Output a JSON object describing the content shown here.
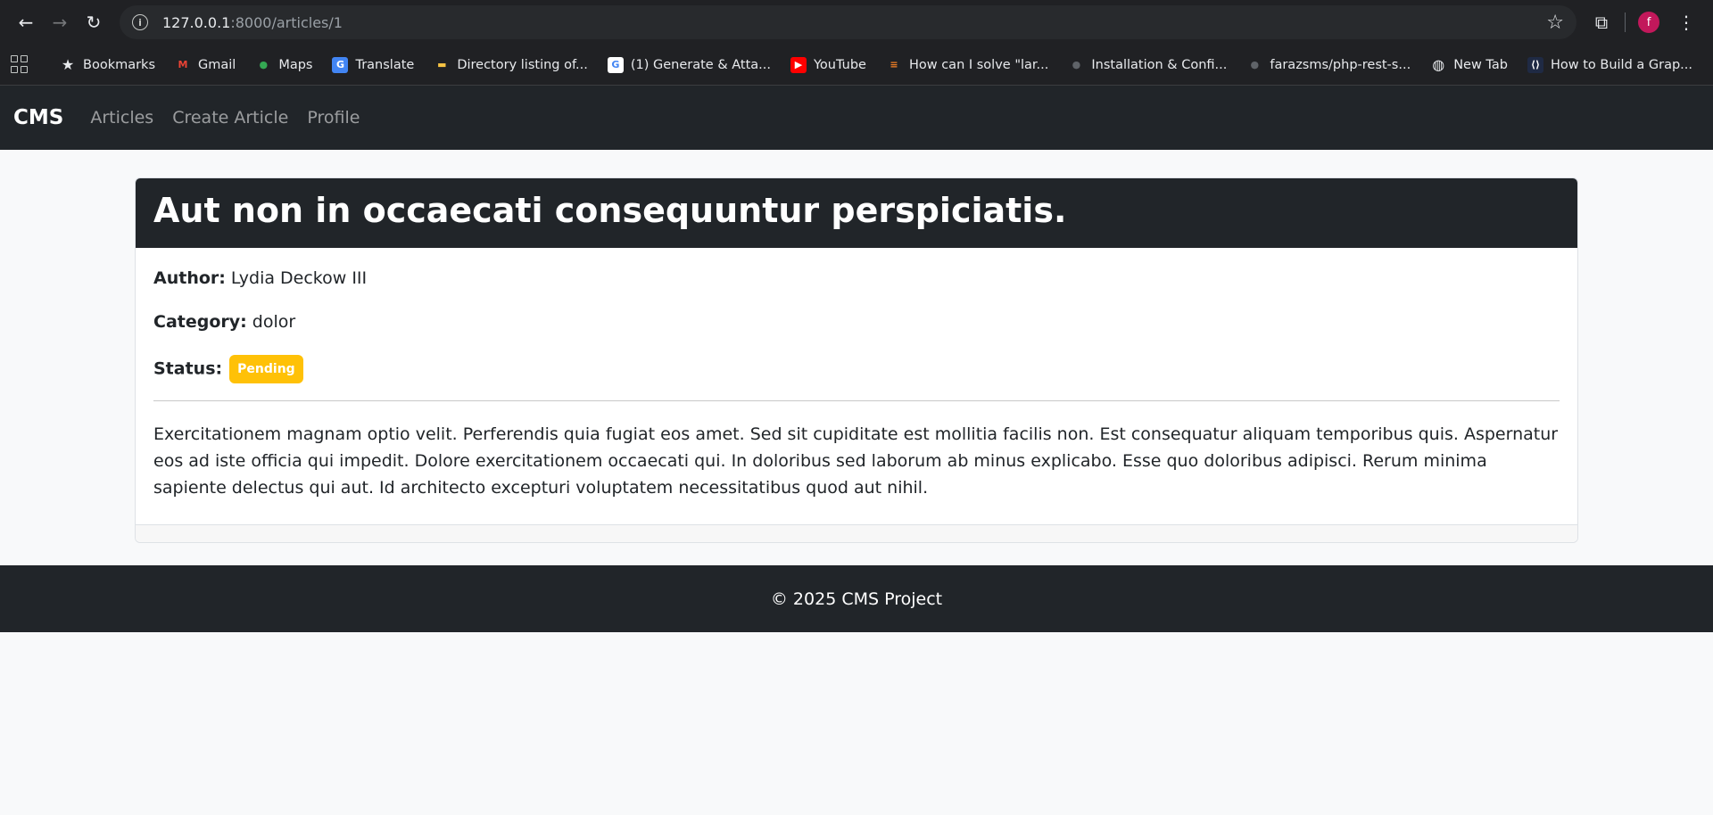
{
  "browser": {
    "url_host": "127.0.0.1",
    "url_rest": ":8000/articles/1",
    "avatar_letter": "f",
    "bookmarks": [
      {
        "label": "Bookmarks",
        "icon": "star-icon"
      },
      {
        "label": "Gmail",
        "icon": "gmail-icon"
      },
      {
        "label": "Maps",
        "icon": "maps-icon"
      },
      {
        "label": "Translate",
        "icon": "translate-icon"
      },
      {
        "label": "Directory listing of...",
        "icon": "folder-icon"
      },
      {
        "label": "(1) Generate & Atta...",
        "icon": "google-icon"
      },
      {
        "label": "YouTube",
        "icon": "youtube-icon"
      },
      {
        "label": "How can I solve \"lar...",
        "icon": "stackoverflow-icon"
      },
      {
        "label": "Installation & Confi...",
        "icon": "github-icon"
      },
      {
        "label": "farazsms/php-rest-s...",
        "icon": "github-icon"
      },
      {
        "label": "New Tab",
        "icon": "globe-icon"
      },
      {
        "label": "How to Build a Grap...",
        "icon": "site-icon"
      }
    ]
  },
  "navbar": {
    "brand": "CMS",
    "links": [
      "Articles",
      "Create Article",
      "Profile"
    ]
  },
  "article": {
    "title": "Aut non in occaecati consequuntur perspiciatis.",
    "author_label": "Author:",
    "author": "Lydia Deckow III",
    "category_label": "Category:",
    "category": "dolor",
    "status_label": "Status:",
    "status": "Pending",
    "status_color": "#ffc107",
    "content": "Exercitationem magnam optio velit. Perferendis quia fugiat eos amet. Sed sit cupiditate est mollitia facilis non. Est consequatur aliquam temporibus quis. Aspernatur eos ad iste officia qui impedit. Dolore exercitationem occaecati qui. In doloribus sed laborum ab minus explicabo. Esse quo doloribus adipisci. Rerum minima sapiente delectus qui aut. Id architecto excepturi voluptatem necessitatibus quod aut nihil."
  },
  "footer": {
    "text": "© 2025 CMS Project"
  }
}
